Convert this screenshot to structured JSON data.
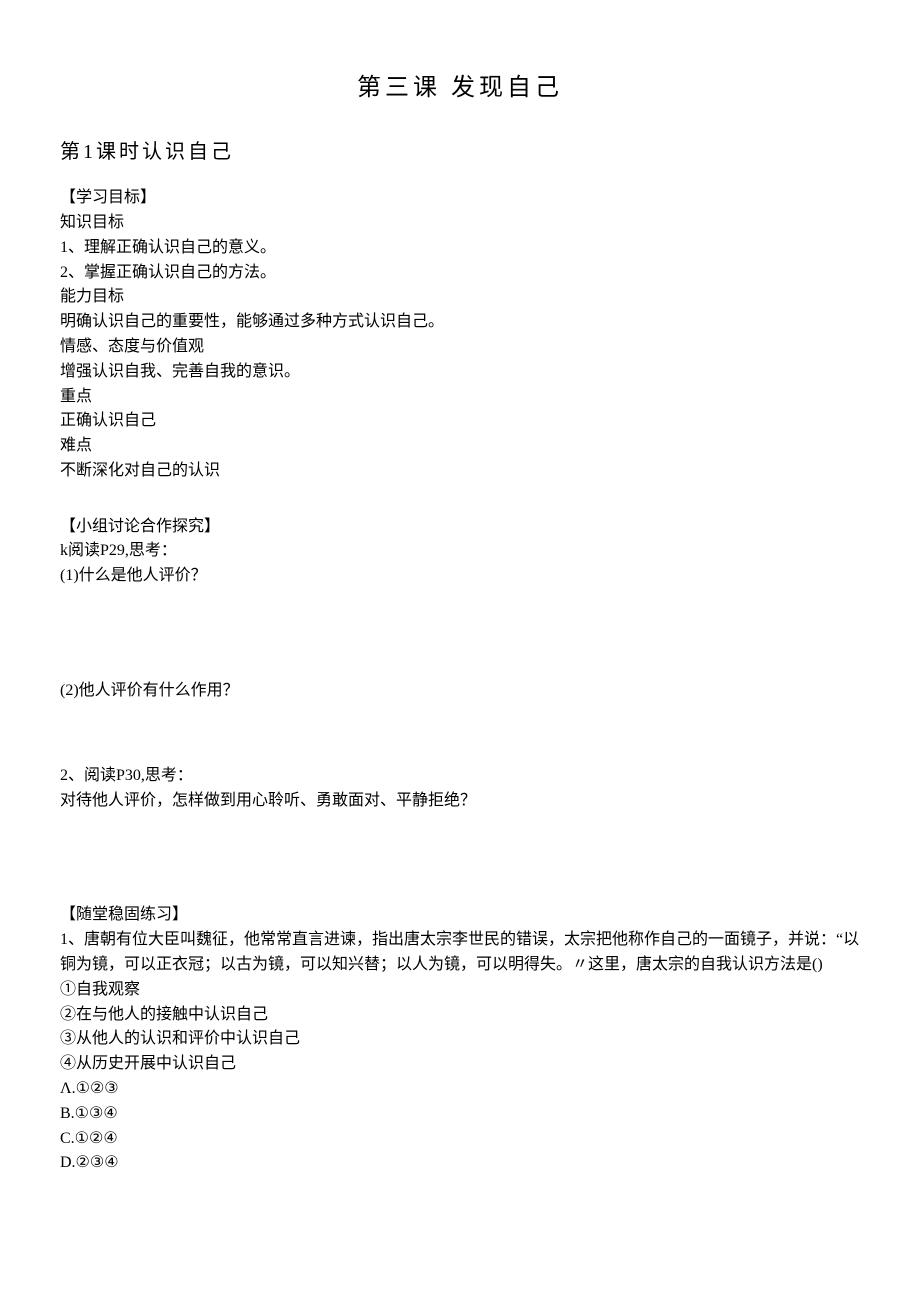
{
  "title_main": "第三课    发现自己",
  "subtitle": "第1课时认识自己",
  "section_objectives_header": "【学习目标】",
  "objectives": {
    "knowledge_label": "知识目标",
    "knowledge_1": "1、理解正确认识自己的意义。",
    "knowledge_2": "2、掌握正确认识自己的方法。",
    "ability_label": "能力目标",
    "ability_1": "明确认识自己的重要性，能够通过多种方式认识自己。",
    "attitude_label": "情感、态度与价值观",
    "attitude_1": "增强认识自我、完善自我的意识。",
    "keypoint_label": "重点",
    "keypoint_1": "正确认识自己",
    "difficulty_label": "难点",
    "difficulty_1": "不断深化对自己的认识"
  },
  "section_group_header": "【小组讨论合作探究】",
  "group": {
    "read1": "k阅读P29,思考：",
    "q1": "(1)什么是他人评价？",
    "q2": "(2)他人评价有什么作用？",
    "read2": "2、阅读P30,思考：",
    "q3": "对待他人评价，怎样做到用心聆听、勇敢面对、平静拒绝？"
  },
  "section_exercise_header": "【随堂稳固练习】",
  "exercise": {
    "q1_stem": "1、唐朝有位大臣叫魏征，他常常直言进谏，指出唐太宗李世民的错误，太宗把他称作自己的一面镜子，并说：“以铜为镜，可以正衣冠；以古为镜，可以知兴替；以人为镜，可以明得失。〃这里，唐太宗的自我认识方法是()",
    "opt1": "①自我观察",
    "opt2": "②在与他人的接触中认识自己",
    "opt3": "③从他人的认识和评价中认识自己",
    "opt4": "④从历史开展中认识自己",
    "choiceA": "Λ.①②③",
    "choiceB": "B.①③④",
    "choiceC": "C.①②④",
    "choiceD": "D.②③④"
  }
}
